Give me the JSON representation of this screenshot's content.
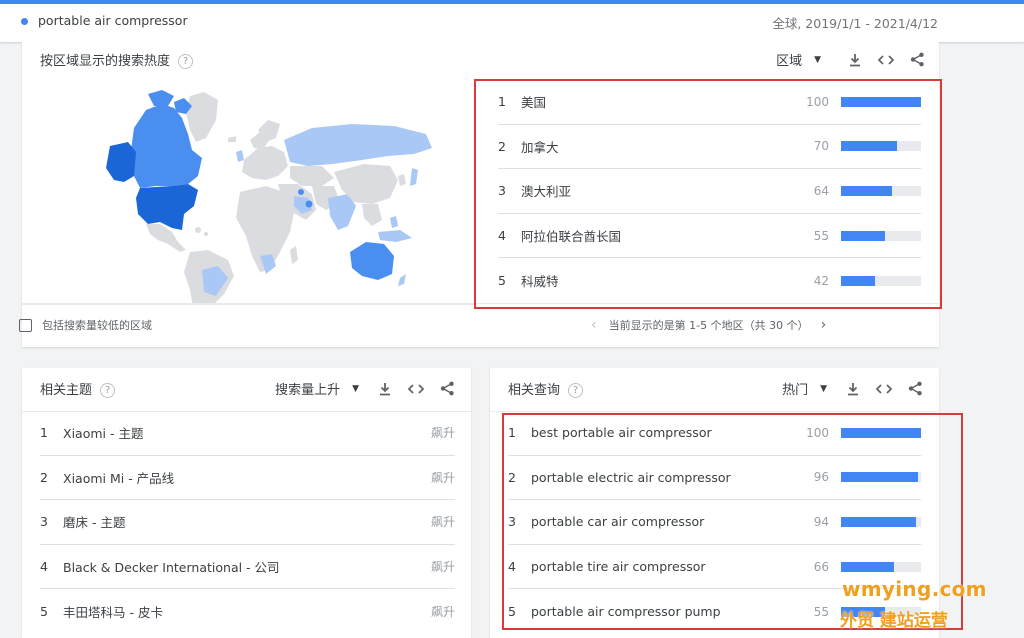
{
  "header": {
    "search_term": "portable air compressor",
    "range": "全球, 2019/1/1 - 2021/4/12"
  },
  "region": {
    "title": "按区域显示的搜索热度",
    "selector_label": "区域",
    "items": [
      {
        "rank": "1",
        "name": "美国",
        "value": "100",
        "pct": 100
      },
      {
        "rank": "2",
        "name": "加拿大",
        "value": "70",
        "pct": 70
      },
      {
        "rank": "3",
        "name": "澳大利亚",
        "value": "64",
        "pct": 64
      },
      {
        "rank": "4",
        "name": "阿拉伯联合酋长国",
        "value": "55",
        "pct": 55
      },
      {
        "rank": "5",
        "name": "科威特",
        "value": "42",
        "pct": 42
      }
    ],
    "checkbox_label": "包括搜索量较低的区域",
    "pager_text": "当前显示的是第 1-5 个地区（共 30 个）"
  },
  "topics": {
    "title": "相关主题",
    "selector_label": "搜索量上升",
    "items": [
      {
        "rank": "1",
        "name": "Xiaomi - 主题",
        "tag": "飙升"
      },
      {
        "rank": "2",
        "name": "Xiaomi Mi - 产品线",
        "tag": "飙升"
      },
      {
        "rank": "3",
        "name": "磨床 - 主题",
        "tag": "飙升"
      },
      {
        "rank": "4",
        "name": "Black & Decker International - 公司",
        "tag": "飙升"
      },
      {
        "rank": "5",
        "name": "丰田塔科马 - 皮卡",
        "tag": "飙升"
      }
    ]
  },
  "queries": {
    "title": "相关查询",
    "selector_label": "热门",
    "items": [
      {
        "rank": "1",
        "name": "best portable air compressor",
        "value": "100",
        "pct": 100
      },
      {
        "rank": "2",
        "name": "portable electric air compressor",
        "value": "96",
        "pct": 96
      },
      {
        "rank": "3",
        "name": "portable car air compressor",
        "value": "94",
        "pct": 94
      },
      {
        "rank": "4",
        "name": "portable tire air compressor",
        "value": "66",
        "pct": 66
      },
      {
        "rank": "5",
        "name": "portable air compressor pump",
        "value": "55",
        "pct": 55
      }
    ]
  },
  "watermark": {
    "line1": "wmying.com",
    "line2": "外贸 建站运营"
  },
  "colors": {
    "accent": "#4285f4",
    "map_high": "#1a66d6",
    "map_mid": "#4a8ff0",
    "map_low": "#a9c8f5",
    "map_none": "#dadce0",
    "highlight_box": "#d93b3b"
  },
  "icons": [
    "help-icon",
    "caret-down-icon",
    "download-icon",
    "embed-icon",
    "share-icon",
    "chevron-left-icon",
    "chevron-right-icon"
  ]
}
